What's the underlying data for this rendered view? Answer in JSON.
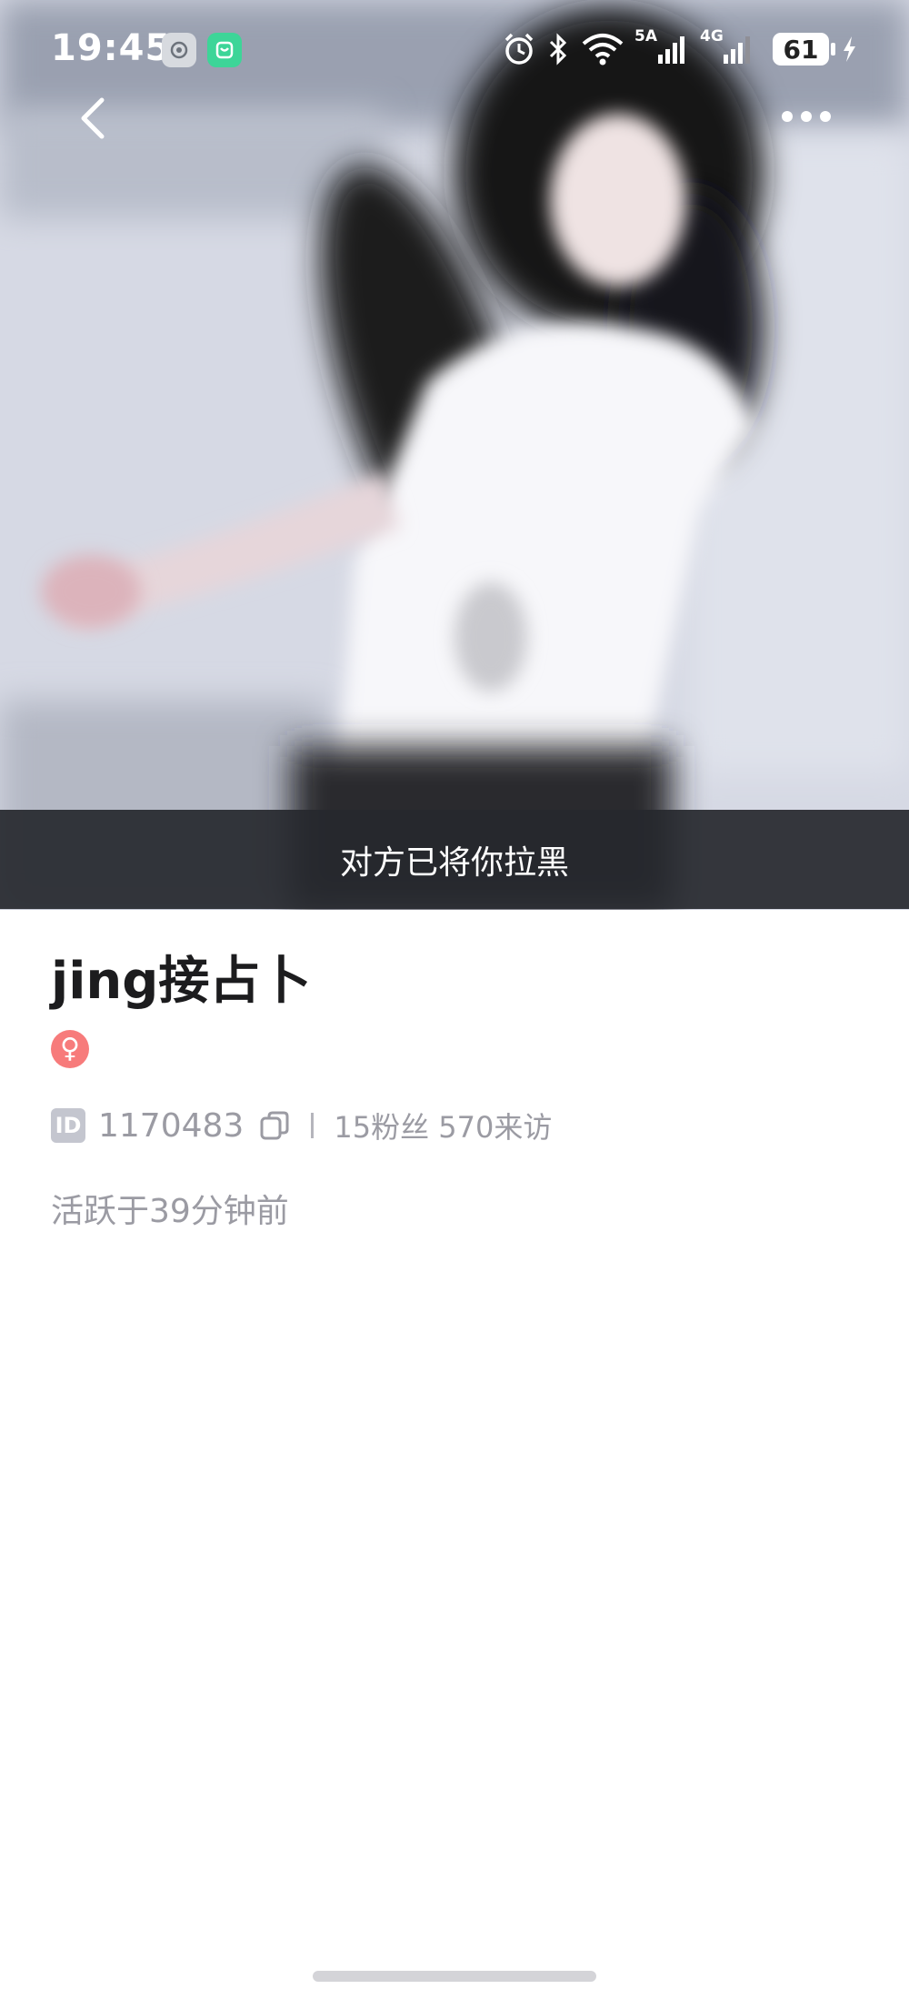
{
  "status_bar": {
    "time": "19:45",
    "network_5g": "5A",
    "network_4g": "4G",
    "battery": "61"
  },
  "header": {
    "back_icon": "chevron-left-icon",
    "more_icon": "more-horizontal-icon"
  },
  "cover": {
    "blocked_notice": "对方已将你拉黑"
  },
  "profile": {
    "username": "jing接占卜",
    "gender_symbol": "♀",
    "id_label": "ID",
    "id_number": "1170483",
    "stats": "15粉丝 570来访",
    "last_active": "活跃于39分钟前"
  },
  "colors": {
    "gender_badge": "#f77b7b",
    "muted_text": "#9b9ba3",
    "blocked_bar": "#26282e"
  }
}
